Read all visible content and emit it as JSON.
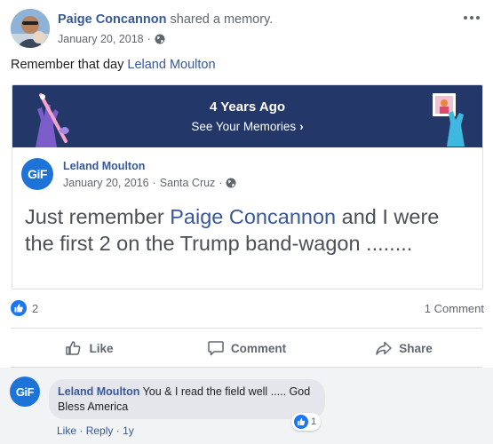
{
  "post": {
    "author": "Paige Concannon",
    "action": "shared a memory.",
    "date": "January 20, 2018",
    "separator": "·",
    "privacy_icon": "globe-icon",
    "more_icon": "more-options-icon",
    "text_prefix": "Remember that day",
    "text_link": "Leland Moulton"
  },
  "memory": {
    "title": "4 Years Ago",
    "link_label": "See Your Memories",
    "link_chevron": "›",
    "banner_color": "#233769"
  },
  "shared_post": {
    "avatar_text": "GiF",
    "author": "Leland Moulton",
    "date": "January 20, 2016",
    "separator": "·",
    "location": "Santa Cruz",
    "privacy_icon": "globe-icon",
    "text_part1": "Just remember ",
    "text_link": "Paige Concannon",
    "text_part2": " and I were the first 2 on the Trump band-wagon ........"
  },
  "stats": {
    "like_count": "2",
    "comment_count": "1 Comment"
  },
  "actions": {
    "like": "Like",
    "comment": "Comment",
    "share": "Share"
  },
  "comment": {
    "avatar_text": "GiF",
    "author": "Leland Moulton",
    "text": "You & I read the field well ..... God Bless America",
    "reaction_count": "1",
    "like_label": "Like",
    "dot1": "·",
    "reply_label": "Reply",
    "dot2": "·",
    "age": "1y"
  },
  "colors": {
    "link": "#385898",
    "facebook_blue": "#1877f2",
    "muted_text": "#606770"
  }
}
